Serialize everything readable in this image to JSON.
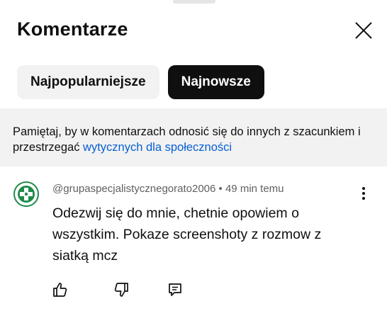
{
  "header": {
    "title": "Komentarze",
    "close_icon": "close-icon"
  },
  "sort_chips": [
    {
      "label": "Najpopularniejsze",
      "selected": false
    },
    {
      "label": "Najnowsze",
      "selected": true
    }
  ],
  "notice": {
    "text": "Pamiętaj, by w komentarzach odnosić się do innych z szacunkiem i przestrzegać ",
    "link_text": "wytycznych dla społeczności"
  },
  "comment": {
    "author": "@grupaspecjalistycznegorato2006",
    "separator": " • ",
    "time": "49 min temu",
    "text": "Odezwij się do mnie, chetnie opowiem o wszystkim. Pokaze screenshoty z rozmow z siatką mcz",
    "avatar_icon": "medical-cross-avatar-icon",
    "menu_icon": "more-vertical-icon",
    "actions": [
      {
        "name": "like",
        "icon": "thumb-up-icon"
      },
      {
        "name": "dislike",
        "icon": "thumb-down-icon"
      },
      {
        "name": "reply",
        "icon": "reply-icon"
      }
    ]
  },
  "colors": {
    "accent_link": "#065fd4",
    "chip_active_bg": "#0f0f0f",
    "chip_inactive_bg": "#f2f2f2",
    "notice_bg": "#f2f2f2",
    "meta_text": "#606060",
    "avatar_green": "#1f8a4c"
  }
}
